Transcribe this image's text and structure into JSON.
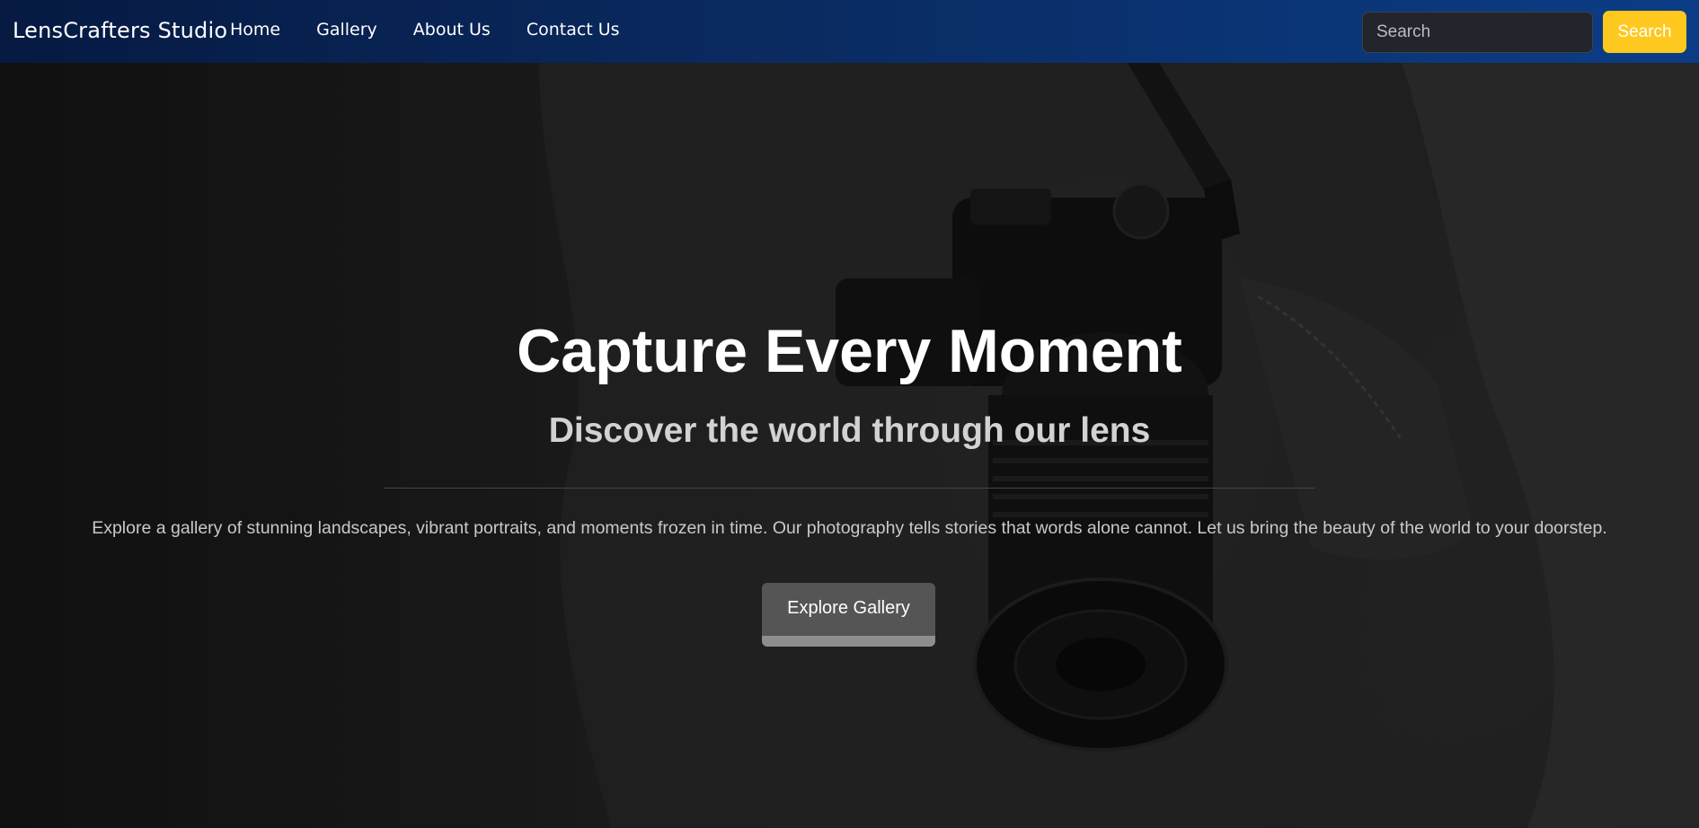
{
  "navbar": {
    "brand": "LensCrafters Studio",
    "links": [
      {
        "label": "Home"
      },
      {
        "label": "Gallery"
      },
      {
        "label": "About Us"
      },
      {
        "label": "Contact Us"
      }
    ],
    "search": {
      "placeholder": "Search",
      "button_label": "Search"
    }
  },
  "hero": {
    "title": "Capture Every Moment",
    "subtitle": "Discover the world through our lens",
    "description": "Explore a gallery of stunning landscapes, vibrant portraits, and moments frozen in time. Our photography tells stories that words alone cannot. Let us bring the beauty of the world to your doorstep.",
    "cta_label": "Explore Gallery"
  },
  "colors": {
    "navbar_start": "#061a42",
    "navbar_end": "#0b3d86",
    "search_button": "#ffc81e",
    "cta_button": "#555555"
  }
}
